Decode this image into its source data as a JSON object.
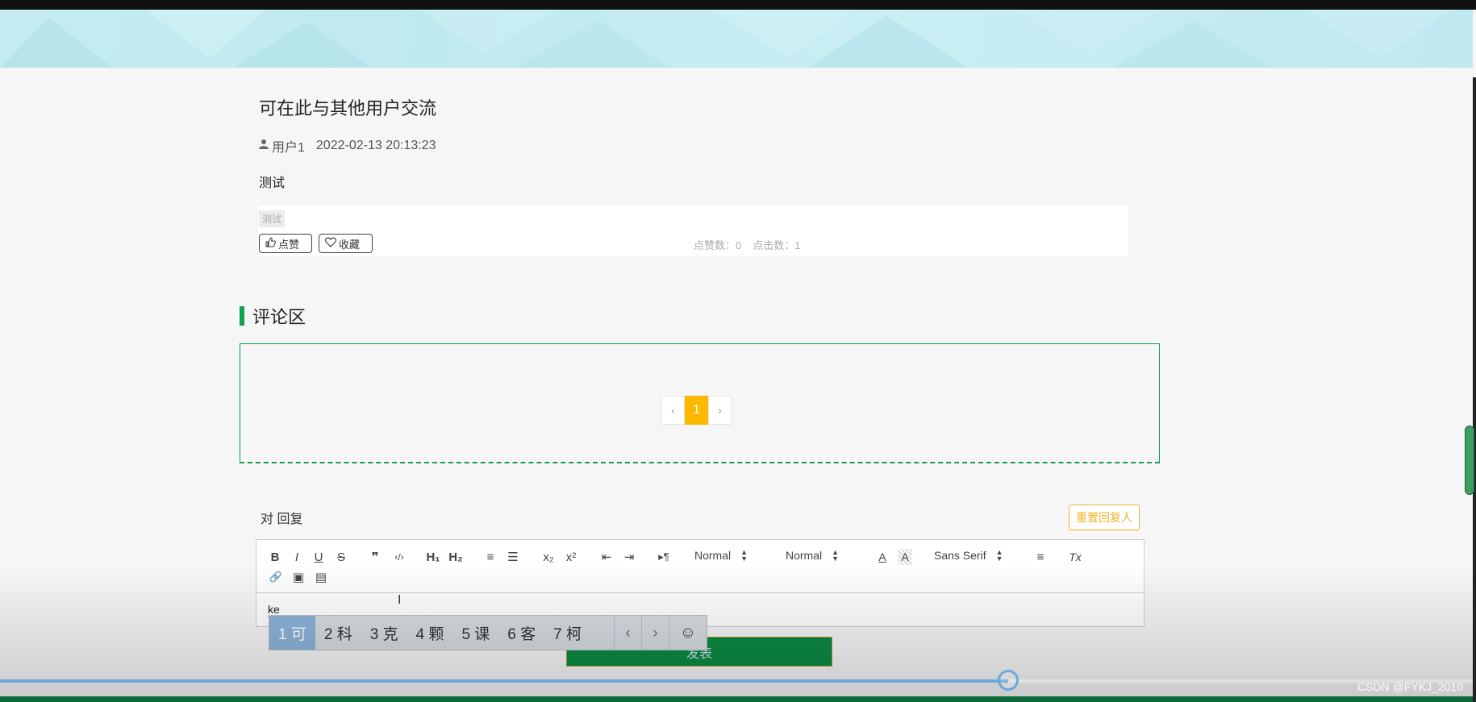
{
  "post": {
    "title": "可在此与其他用户交流",
    "author": "用户1",
    "date": "2022-02-13 20:13:23",
    "body": "测试",
    "tag": "测试",
    "like_label": "点赞",
    "favorite_label": "收藏",
    "likes_text": "点赞数：0",
    "clicks_text": "点击数：1"
  },
  "comments": {
    "section_title": "评论区",
    "pager": {
      "prev": "‹",
      "page": "1",
      "next": "›"
    }
  },
  "reply": {
    "label": "对 回复",
    "reset_label": "重置回复人",
    "toolbar": {
      "bold": "B",
      "italic": "I",
      "underline": "U",
      "strike": "S",
      "blockquote": "❞",
      "code": "‹/›",
      "h1": "H₁",
      "h2": "H₂",
      "ordered_list": "≡",
      "bullet_list": "☰",
      "subscript": "x₂",
      "superscript": "x²",
      "outdent": "⇤",
      "indent": "⇥",
      "direction": "▸¶",
      "size_select": "Normal",
      "header_select": "Normal",
      "color": "A",
      "background": "A",
      "font_select": "Sans Serif",
      "align": "≡",
      "clean": "Tx",
      "link": "🔗",
      "image": "▣",
      "video": "▤"
    },
    "editor_text": "ke",
    "submit_label": "发表"
  },
  "ime": {
    "candidates": [
      "1 可",
      "2 科",
      "3 克",
      "4 颗",
      "5 课",
      "6 客",
      "7 柯"
    ],
    "prev": "‹",
    "next": "›",
    "emoji": "☺"
  },
  "video_overlay": {
    "progress": 0.683,
    "watermark": "CSDN @FYKJ_2010"
  },
  "colors": {
    "accent_green": "#10a056",
    "pager_active": "#ffb800",
    "reset_orange": "#f0b22e",
    "submit_green": "#0b8a43"
  }
}
